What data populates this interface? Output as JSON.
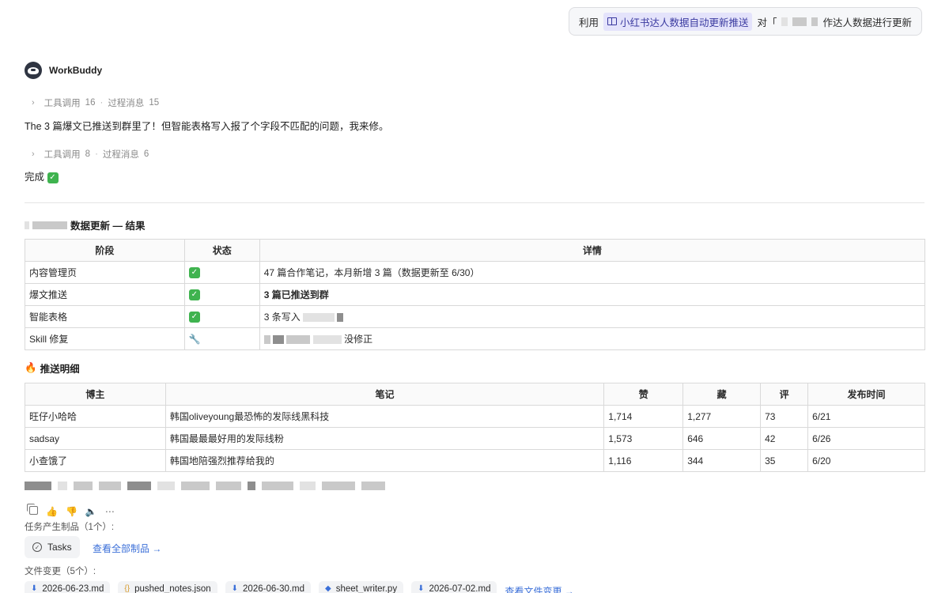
{
  "user_message": {
    "prefix": "利用",
    "skill": "小红书达人数据自动更新推送",
    "mid": "对「",
    "suffix": "作达人数据进行更新"
  },
  "agent": {
    "name": "WorkBuddy"
  },
  "step1": {
    "tools_label": "工具调用",
    "tools_count": "16",
    "process_label": "过程消息",
    "process_count": "15"
  },
  "msg1": "The 3 篇爆文已推送到群里了！但智能表格写入报了个字段不匹配的问题，我来修。",
  "step2": {
    "tools_label": "工具调用",
    "tools_count": "8",
    "process_label": "过程消息",
    "process_count": "6"
  },
  "msg2": "完成",
  "results": {
    "title_suffix": "数据更新 — 结果",
    "headers": [
      "阶段",
      "状态",
      "详情"
    ],
    "rows": [
      {
        "stage": "内容管理页",
        "status": "✅",
        "detail": "47 篇合作笔记，本月新增 3 篇（数据更新至 6/30）"
      },
      {
        "stage": "爆文推送",
        "status": "✅",
        "detail": "3 篇已推送到群"
      },
      {
        "stage": "智能表格",
        "status": "✅",
        "detail": "3 条写入"
      },
      {
        "stage": "Skill 修复",
        "status": "🔧",
        "detail": "没修正"
      }
    ]
  },
  "push": {
    "title": "推送明细",
    "headers": [
      "博主",
      "笔记",
      "赞",
      "藏",
      "评",
      "发布时间"
    ],
    "rows": [
      {
        "blogger": "旺仔小哈哈",
        "note": "韩国oliveyoung最恐怖的发际线黑科技",
        "likes": "1,714",
        "saves": "1,277",
        "comments": "73",
        "date": "6/21"
      },
      {
        "blogger": "sadsay",
        "note": "韩国最最最好用的发际线粉",
        "likes": "1,573",
        "saves": "646",
        "comments": "42",
        "date": "6/26"
      },
      {
        "blogger": "小查饿了",
        "note": "韩国地陪强烈推荐给我的",
        "likes": "1,116",
        "saves": "344",
        "comments": "35",
        "date": "6/20"
      }
    ]
  },
  "artifacts": {
    "label": "任务产生制品（1个）:",
    "tasks": "Tasks",
    "view_all": "查看全部制品 →"
  },
  "changes": {
    "label": "文件变更（5个）:",
    "files": [
      "2026-06-23.md",
      "pushed_notes.json",
      "2026-06-30.md",
      "sheet_writer.py",
      "2026-07-02.md"
    ],
    "view": "查看文件变更 →"
  },
  "colors": {
    "accent": "#3b6fd8",
    "skill_bg": "#e4e3fb",
    "check": "#3fb34f"
  }
}
